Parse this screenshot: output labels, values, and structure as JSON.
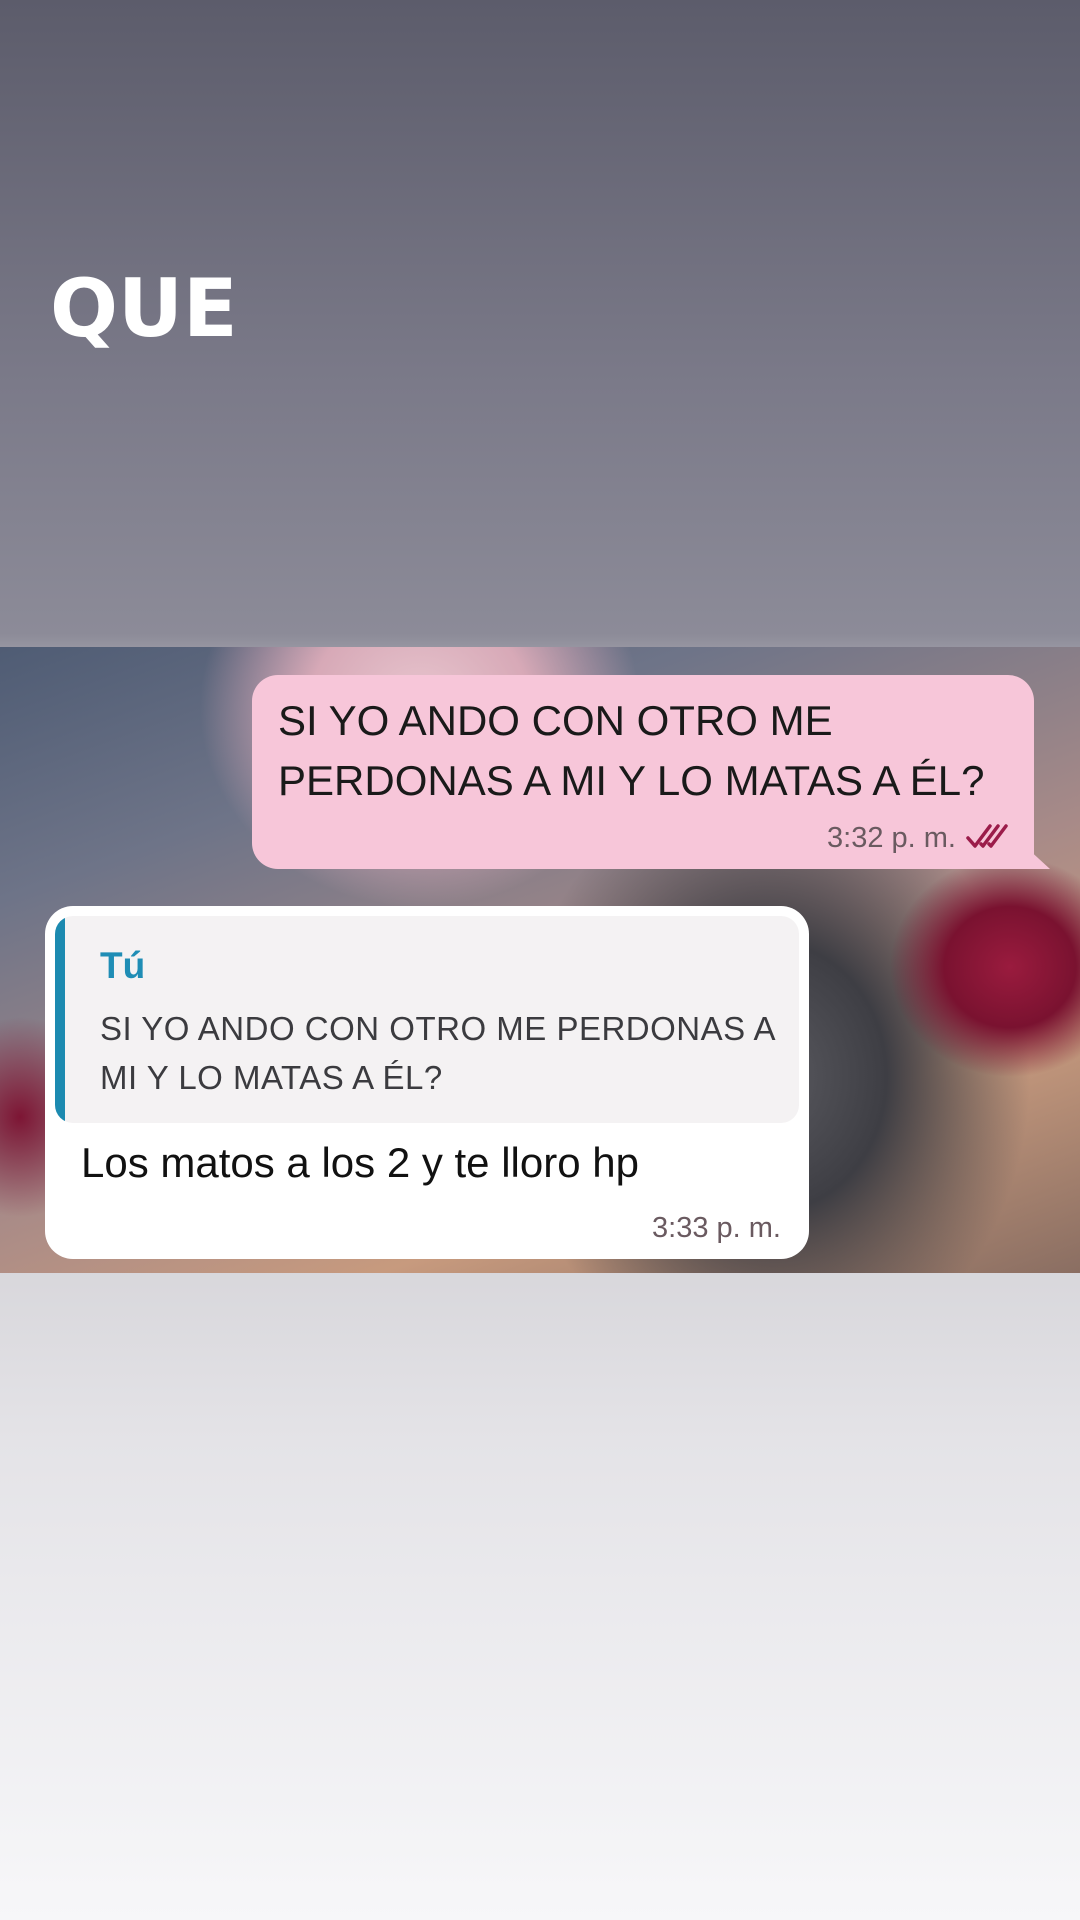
{
  "story": {
    "caption": "QUE"
  },
  "chat": {
    "outgoing": {
      "text": "SI YO ANDO CON OTRO ME PERDONAS A MI Y LO MATAS A ÉL?",
      "time": "3:32 p. m.",
      "status_icon": "double-check-read-icon",
      "bubble_color": "#f7c6d9",
      "check_color": "#9b1c4a"
    },
    "incoming": {
      "reply_author": "Tú",
      "reply_text": "SI YO ANDO CON OTRO ME PERDONAS A MI Y LO MATAS A ÉL?",
      "text": "Los matos a los 2 y te lloro hp",
      "time": "3:33 p. m.",
      "reply_accent": "#1f8db5"
    }
  }
}
